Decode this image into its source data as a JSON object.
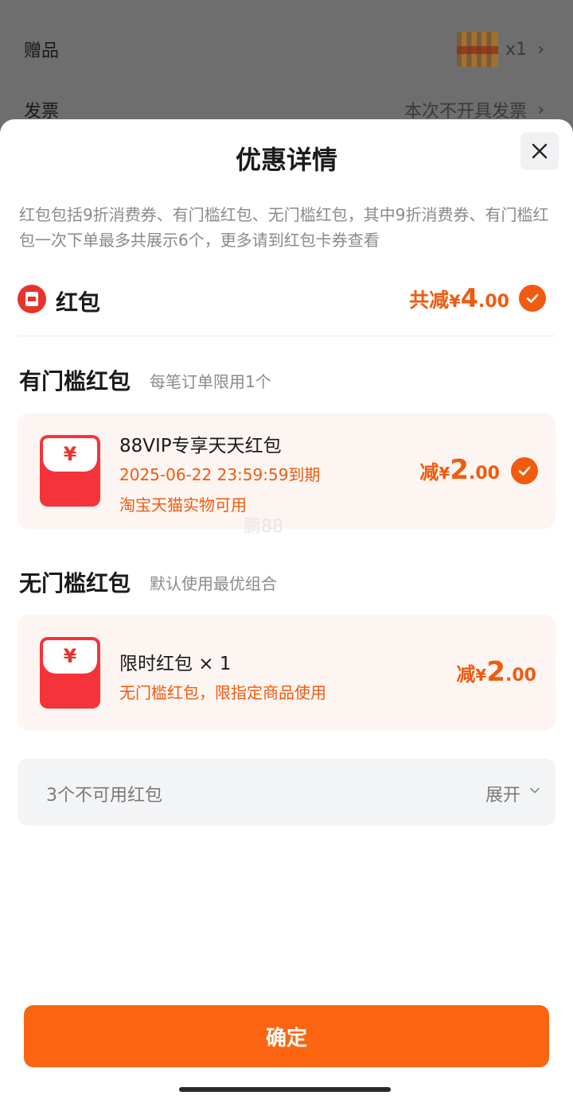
{
  "background_page": {
    "gift_label": "赠品",
    "gift_qty": "x1",
    "invoice_label": "发票",
    "invoice_value": "本次不开具发票",
    "chevron": "›"
  },
  "sheet": {
    "title": "优惠详情",
    "close_icon": "close-icon",
    "description": "红包包括9折消费券、有门槛红包、无门槛红包，其中9折消费券、有门槛红包一次下单最多共展示6个，更多请到红包卡券查看",
    "red_packet": {
      "label": "红包",
      "total_prefix": "共减",
      "currency": "¥",
      "amount_int": "4",
      "amount_dec": ".00",
      "selected": true
    },
    "threshold_section": {
      "title": "有门槛红包",
      "subtitle": "每笔订单限用1个",
      "cards": [
        {
          "yen": "¥",
          "title": "88VIP专享天天红包",
          "expiry": "2025-06-22 23:59:59到期",
          "scope": "淘宝天猫实物可用",
          "amt_prefix": "减",
          "currency": "¥",
          "amount_int": "2",
          "amount_dec": ".00",
          "selected": true
        }
      ]
    },
    "no_threshold_section": {
      "title": "无门槛红包",
      "subtitle": "默认使用最优组合",
      "cards": [
        {
          "yen": "¥",
          "title": "限时红包 × 1",
          "desc": "无门槛红包，限指定商品使用",
          "amt_prefix": "减",
          "currency": "¥",
          "amount_int": "2",
          "amount_dec": ".00"
        }
      ]
    },
    "unavailable": {
      "label": "3个不可用红包",
      "expand_label": "展开"
    },
    "watermark": "鹏88",
    "confirm_label": "确定"
  },
  "colors": {
    "accent": "#f15a0f",
    "button": "#fb6410",
    "red": "#f4343a"
  }
}
